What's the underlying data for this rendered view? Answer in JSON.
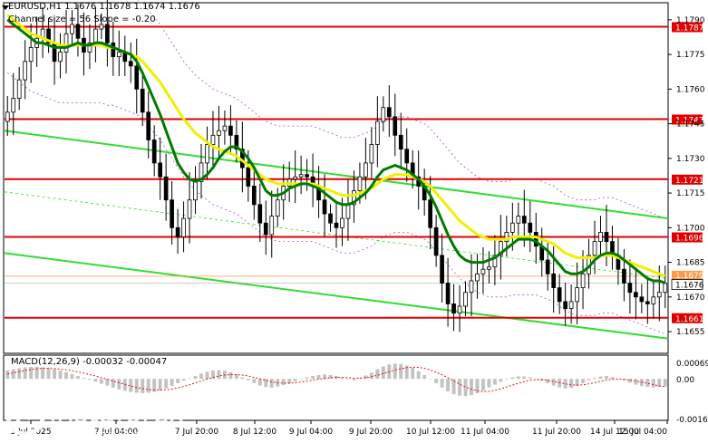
{
  "header": {
    "symbol_line": "EURUSD,H1  1.1676 1.1678 1.1674 1.1676",
    "channel_line": "Channel size = 56 Slope = -0.20"
  },
  "macd": {
    "label": "MACD(12,26,9) -0.00032 -0.00047",
    "ticks": [
      "0.00069",
      "0.00",
      "-0.00166"
    ]
  },
  "logo": {
    "word": "instaforex",
    "tagline": "Instant Forex Trading"
  },
  "colors": {
    "candles": "#000000",
    "ma_fast": "#007a00",
    "ma_slow": "#f0f000",
    "channel": "#33dd33",
    "level_line": "#e00000",
    "bands": "#b04fd0",
    "price_line": "#ff9a4a",
    "macd_hist": "#c2c2c2",
    "macd_signal": "#dd0000"
  },
  "chart_data": {
    "type": "candlestick",
    "title": "EURUSD,H1",
    "ylim": [
      1.1646,
      1.1797
    ],
    "y_ticks": [
      "1.1790",
      "1.1775",
      "1.1760",
      "1.1745",
      "1.1730",
      "1.1715",
      "1.1700",
      "1.1685",
      "1.1670",
      "1.1655"
    ],
    "x_ticks": [
      "3 Jul 2025",
      "7 Jul 04:00",
      "7 Jul 20:00",
      "8 Jul 12:00",
      "9 Jul 04:00",
      "9 Jul 20:00",
      "10 Jul 12:00",
      "11 Jul 04:00",
      "11 Jul 20:00",
      "14 Jul 12:00",
      "15 Jul 04:00"
    ],
    "price_levels": [
      {
        "label": "1.1787",
        "value": 1.1787
      },
      {
        "label": "1.1747",
        "value": 1.1747
      },
      {
        "label": "1.1721",
        "value": 1.1721
      },
      {
        "label": "1.1696",
        "value": 1.1696
      },
      {
        "label": "1.1661",
        "value": 1.1661
      }
    ],
    "current_price": {
      "label": "1.1676",
      "value": 1.1676
    },
    "ma_label": {
      "label": "1.1679",
      "value": 1.1679
    },
    "close": [
      1.175,
      1.1756,
      1.1764,
      1.1772,
      1.1778,
      1.1782,
      1.1786,
      1.178,
      1.1772,
      1.1776,
      1.1784,
      1.1788,
      1.1782,
      1.1776,
      1.178,
      1.1786,
      1.1788,
      1.178,
      1.1774,
      1.1776,
      1.1772,
      1.177,
      1.176,
      1.175,
      1.1738,
      1.1728,
      1.1722,
      1.1712,
      1.17,
      1.1696,
      1.1704,
      1.1712,
      1.172,
      1.1728,
      1.1736,
      1.174,
      1.1742,
      1.1744,
      1.174,
      1.1734,
      1.1726,
      1.1718,
      1.171,
      1.1702,
      1.1697,
      1.1705,
      1.1712,
      1.1718,
      1.1721,
      1.1722,
      1.1723,
      1.1722,
      1.1718,
      1.1712,
      1.1706,
      1.1702,
      1.17,
      1.1704,
      1.171,
      1.1716,
      1.1722,
      1.1728,
      1.1736,
      1.1746,
      1.1752,
      1.1748,
      1.174,
      1.1734,
      1.1728,
      1.1722,
      1.1718,
      1.1712,
      1.17,
      1.1688,
      1.1676,
      1.1667,
      1.1663,
      1.1666,
      1.1672,
      1.1677,
      1.168,
      1.1682,
      1.1683,
      1.1688,
      1.1694,
      1.1698,
      1.1702,
      1.1705,
      1.1702,
      1.1698,
      1.1692,
      1.1686,
      1.168,
      1.1674,
      1.1668,
      1.1665,
      1.1668,
      1.1674,
      1.168,
      1.1688,
      1.1694,
      1.1698,
      1.1694,
      1.1688,
      1.1682,
      1.1676,
      1.1672,
      1.167,
      1.1668,
      1.1667,
      1.167,
      1.1672,
      1.1676
    ],
    "ma_fast": [
      1.179,
      1.1788,
      1.1786,
      1.1784,
      1.1782,
      1.178,
      1.178,
      1.1779,
      1.1778,
      1.1778,
      1.1778,
      1.1779,
      1.178,
      1.1779,
      1.1779,
      1.178,
      1.178,
      1.1779,
      1.1778,
      1.1777,
      1.1776,
      1.1775,
      1.1772,
      1.1767,
      1.1761,
      1.1755,
      1.1749,
      1.1742,
      1.1735,
      1.1728,
      1.1724,
      1.1721,
      1.172,
      1.1721,
      1.1723,
      1.1726,
      1.173,
      1.1733,
      1.1735,
      1.1735,
      1.1733,
      1.173,
      1.1726,
      1.1721,
      1.1716,
      1.1714,
      1.1714,
      1.1715,
      1.1717,
      1.1718,
      1.1719,
      1.1719,
      1.1718,
      1.1717,
      1.1715,
      1.1713,
      1.1711,
      1.171,
      1.171,
      1.1711,
      1.1713,
      1.1715,
      1.1718,
      1.1722,
      1.1725,
      1.1726,
      1.1727,
      1.1726,
      1.1725,
      1.1723,
      1.1721,
      1.1718,
      1.1714,
      1.1709,
      1.1703,
      1.1697,
      1.1692,
      1.1688,
      1.1686,
      1.1685,
      1.1685,
      1.1685,
      1.1686,
      1.1687,
      1.1689,
      1.1691,
      1.1693,
      1.1695,
      1.1695,
      1.1695,
      1.1694,
      1.1692,
      1.169,
      1.1687,
      1.1684,
      1.1681,
      1.168,
      1.168,
      1.1681,
      1.1683,
      1.1686,
      1.1688,
      1.1689,
      1.1689,
      1.1688,
      1.1686,
      1.1684,
      1.1682,
      1.168,
      1.1678,
      1.1677,
      1.1677,
      1.1676
    ],
    "ma_slow": [
      1.1792,
      1.179,
      1.1788,
      1.1786,
      1.1784,
      1.1783,
      1.1782,
      1.1781,
      1.178,
      1.1779,
      1.1779,
      1.1779,
      1.1779,
      1.1779,
      1.1779,
      1.1779,
      1.1779,
      1.1778,
      1.1778,
      1.1777,
      1.1776,
      1.1775,
      1.1774,
      1.1772,
      1.1769,
      1.1766,
      1.1763,
      1.1759,
      1.1755,
      1.1751,
      1.1747,
      1.1744,
      1.1741,
      1.1739,
      1.1737,
      1.1735,
      1.1734,
      1.1733,
      1.1732,
      1.1731,
      1.1729,
      1.1727,
      1.1725,
      1.1723,
      1.1721,
      1.172,
      1.1719,
      1.1719,
      1.1719,
      1.1719,
      1.1719,
      1.1719,
      1.1719,
      1.1718,
      1.1717,
      1.1716,
      1.1715,
      1.1714,
      1.1714,
      1.1714,
      1.1715,
      1.1716,
      1.1717,
      1.1719,
      1.1721,
      1.1722,
      1.1723,
      1.1723,
      1.1723,
      1.1722,
      1.1721,
      1.172,
      1.1718,
      1.1715,
      1.1712,
      1.1709,
      1.1706,
      1.1703,
      1.1701,
      1.1699,
      1.1697,
      1.1696,
      1.1695,
      1.1695,
      1.1695,
      1.1695,
      1.1696,
      1.1696,
      1.1696,
      1.1696,
      1.1696,
      1.1695,
      1.1694,
      1.1693,
      1.1691,
      1.1689,
      1.1688,
      1.1687,
      1.1687,
      1.1687,
      1.1687,
      1.1688,
      1.1688,
      1.1688,
      1.1687,
      1.1686,
      1.1685,
      1.1684,
      1.1683,
      1.1682,
      1.1681,
      1.168,
      1.1679
    ],
    "channel_upper": [
      {
        "x": 0,
        "y": 1.1742
      },
      {
        "x": 1,
        "y": 1.1704
      }
    ],
    "channel_lower": [
      {
        "x": 0,
        "y": 1.1689
      },
      {
        "x": 1,
        "y": 1.1652
      }
    ],
    "macd_hist": [
      0.00035,
      0.0004,
      0.00045,
      0.00048,
      0.0005,
      0.0005,
      0.00048,
      0.00045,
      0.0004,
      0.00035,
      0.00028,
      0.0002,
      0.00012,
      4e-05,
      -4e-05,
      -0.00012,
      -0.0002,
      -0.00028,
      -0.00036,
      -0.00044,
      -0.0005,
      -0.00055,
      -0.00058,
      -0.0006,
      -0.00058,
      -0.00054,
      -0.00048,
      -0.0004,
      -0.0003,
      -0.00018,
      -8e-05,
      2e-05,
      0.00012,
      0.00022,
      0.0003,
      0.00035,
      0.00036,
      0.00034,
      0.00028,
      0.00018,
      6e-05,
      -6e-05,
      -0.00018,
      -0.00028,
      -0.00034,
      -0.00036,
      -0.00032,
      -0.00026,
      -0.00018,
      -0.0001,
      -2e-05,
      6e-05,
      0.00012,
      0.00016,
      0.00018,
      0.00016,
      0.00012,
      6e-05,
      0.0,
      -6e-05,
      4e-05,
      0.00014,
      0.00026,
      0.0004,
      0.00052,
      0.0006,
      0.00064,
      0.00062,
      0.00056,
      0.00046,
      0.00032,
      0.00016,
      0.0,
      -0.00018,
      -0.00036,
      -0.00052,
      -0.00064,
      -0.0007,
      -0.00072,
      -0.00068,
      -0.0006,
      -0.00048,
      -0.00036,
      -0.00024,
      -0.00012,
      -2e-05,
      6e-05,
      0.0001,
      0.0001,
      6e-05,
      0.0,
      -8e-05,
      -0.00018,
      -0.00028,
      -0.00036,
      -0.0004,
      -0.00038,
      -0.0003,
      -0.00018,
      -6e-05,
      4e-05,
      0.0001,
      0.00012,
      8e-05,
      2e-05,
      -6e-05,
      -0.00016,
      -0.00024,
      -0.0003,
      -0.00034,
      -0.00036,
      -0.00034,
      -0.00032
    ],
    "macd_signal": [
      0.0002,
      0.00025,
      0.0003,
      0.00035,
      0.00039,
      0.00042,
      0.00044,
      0.00044,
      0.00043,
      0.00041,
      0.00038,
      0.00034,
      0.00029,
      0.00024,
      0.00018,
      0.00012,
      5e-05,
      -2e-05,
      -9e-05,
      -0.00016,
      -0.00023,
      -0.0003,
      -0.00036,
      -0.00041,
      -0.00045,
      -0.00047,
      -0.00047,
      -0.00046,
      -0.00043,
      -0.00038,
      -0.00032,
      -0.00025,
      -0.00017,
      -9e-05,
      -1e-05,
      6e-05,
      0.00012,
      0.00016,
      0.00018,
      0.00018,
      0.00016,
      0.00012,
      6e-05,
      0.0,
      -6e-05,
      -0.00012,
      -0.00016,
      -0.00018,
      -0.00018,
      -0.00016,
      -0.00013,
      -9e-05,
      -5e-05,
      -1e-05,
      2e-05,
      5e-05,
      6e-05,
      6e-05,
      5e-05,
      3e-05,
      3e-05,
      5e-05,
      9e-05,
      0.00015,
      0.00022,
      0.0003,
      0.00037,
      0.00043,
      0.00047,
      0.00049,
      0.00048,
      0.00044,
      0.00037,
      0.00028,
      0.00017,
      5e-05,
      -9e-05,
      -0.00022,
      -0.00034,
      -0.00043,
      -0.0005,
      -0.00053,
      -0.00052,
      -0.00048,
      -0.00042,
      -0.00034,
      -0.00026,
      -0.00018,
      -0.00011,
      -6e-05,
      -3e-05,
      -3e-05,
      -6e-05,
      -0.00011,
      -0.00016,
      -0.00021,
      -0.00025,
      -0.00026,
      -0.00025,
      -0.00021,
      -0.00016,
      -0.0001,
      -5e-05,
      -2e-05,
      -1e-05,
      -2e-05,
      -5e-05,
      -9e-05,
      -0.00014,
      -0.00019,
      -0.00024,
      -0.00029,
      -0.00033
    ],
    "grid": false,
    "legend": "none"
  }
}
